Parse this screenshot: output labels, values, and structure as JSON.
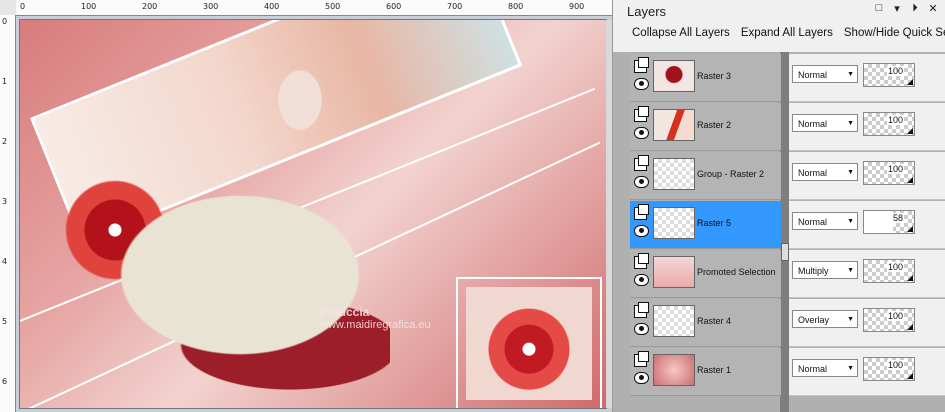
{
  "rulers": {
    "top_ticks": [
      "0",
      "100",
      "200",
      "300",
      "400",
      "500",
      "600",
      "700",
      "800",
      "900"
    ],
    "left_ticks": [
      "0",
      "1",
      "2",
      "3",
      "4",
      "5",
      "6"
    ]
  },
  "canvas": {
    "watermark": "Pinuccia",
    "watermark_url": "www.maidiregrafica.eu"
  },
  "panel": {
    "title": "Layers",
    "toolbar": {
      "collapse": "Collapse All Layers",
      "expand": "Expand All Layers",
      "quick_search": "Show/Hide Quick Sea"
    }
  },
  "layers": [
    {
      "name": "Raster 3",
      "blend": "Normal",
      "opacity": 100,
      "thumb": "t-raster3"
    },
    {
      "name": "Raster 2",
      "blend": "Normal",
      "opacity": 100,
      "thumb": "t-raster2"
    },
    {
      "name": "Group - Raster 2",
      "blend": "Normal",
      "opacity": 100,
      "thumb": "t-group"
    },
    {
      "name": "Raster 5",
      "blend": "Normal",
      "opacity": 58,
      "thumb": "t-blank",
      "selected": true
    },
    {
      "name": "Promoted Selection",
      "blend": "Multiply",
      "opacity": 100,
      "thumb": "t-promoted"
    },
    {
      "name": "Raster 4",
      "blend": "Overlay",
      "opacity": 100,
      "thumb": "t-blank"
    },
    {
      "name": "Raster 1",
      "blend": "Normal",
      "opacity": 100,
      "thumb": "t-raster1"
    }
  ],
  "colors": {
    "selection": "#3399ff",
    "canvas_bg": "#c9cfd8"
  }
}
